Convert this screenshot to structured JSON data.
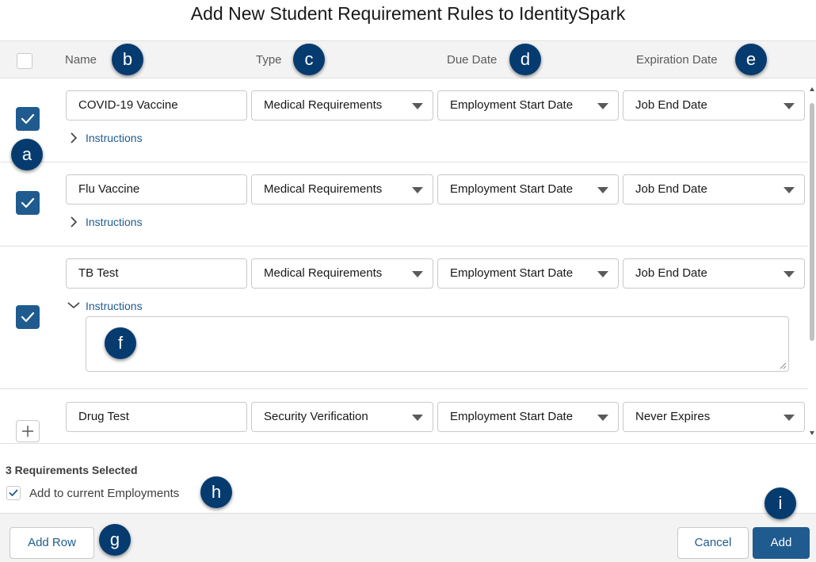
{
  "title": "Add New Student Requirement Rules to IdentitySpark",
  "columns": {
    "name": "Name",
    "type": "Type",
    "due_date": "Due Date",
    "expiration_date": "Expiration Date"
  },
  "rows": [
    {
      "name": "COVID-19 Vaccine",
      "type": "Medical Requirements",
      "due": "Employment Start Date",
      "expiration": "Job End Date",
      "checked": true,
      "instructions_label": "Instructions",
      "expanded": false
    },
    {
      "name": "Flu Vaccine",
      "type": "Medical Requirements",
      "due": "Employment Start Date",
      "expiration": "Job End Date",
      "checked": true,
      "instructions_label": "Instructions",
      "expanded": false
    },
    {
      "name": "TB Test",
      "type": "Medical Requirements",
      "due": "Employment Start Date",
      "expiration": "Job End Date",
      "checked": true,
      "instructions_label": "Instructions",
      "expanded": true
    },
    {
      "name": "Drug Test",
      "type": "Security Verification",
      "due": "Employment Start Date",
      "expiration": "Never Expires",
      "checked": false
    }
  ],
  "selection": {
    "count_text": "3 Requirements Selected",
    "add_current_label": "Add to current Employments",
    "add_current_checked": true
  },
  "buttons": {
    "add_row": "Add Row",
    "cancel": "Cancel",
    "add": "Add"
  },
  "callouts": {
    "a": "a",
    "b": "b",
    "c": "c",
    "d": "d",
    "e": "e",
    "f": "f",
    "g": "g",
    "h": "h",
    "i": "i"
  },
  "colors": {
    "brand": "#1f5b8f",
    "callout": "#053b6f",
    "header_bg": "#f3f3f3"
  },
  "icons": {
    "check": "check-icon",
    "chevron_right": "chevron-right-icon",
    "chevron_down": "chevron-down-icon",
    "dropdown": "dropdown-arrow-icon",
    "plus": "plus-icon",
    "resize": "resize-grip-icon"
  }
}
